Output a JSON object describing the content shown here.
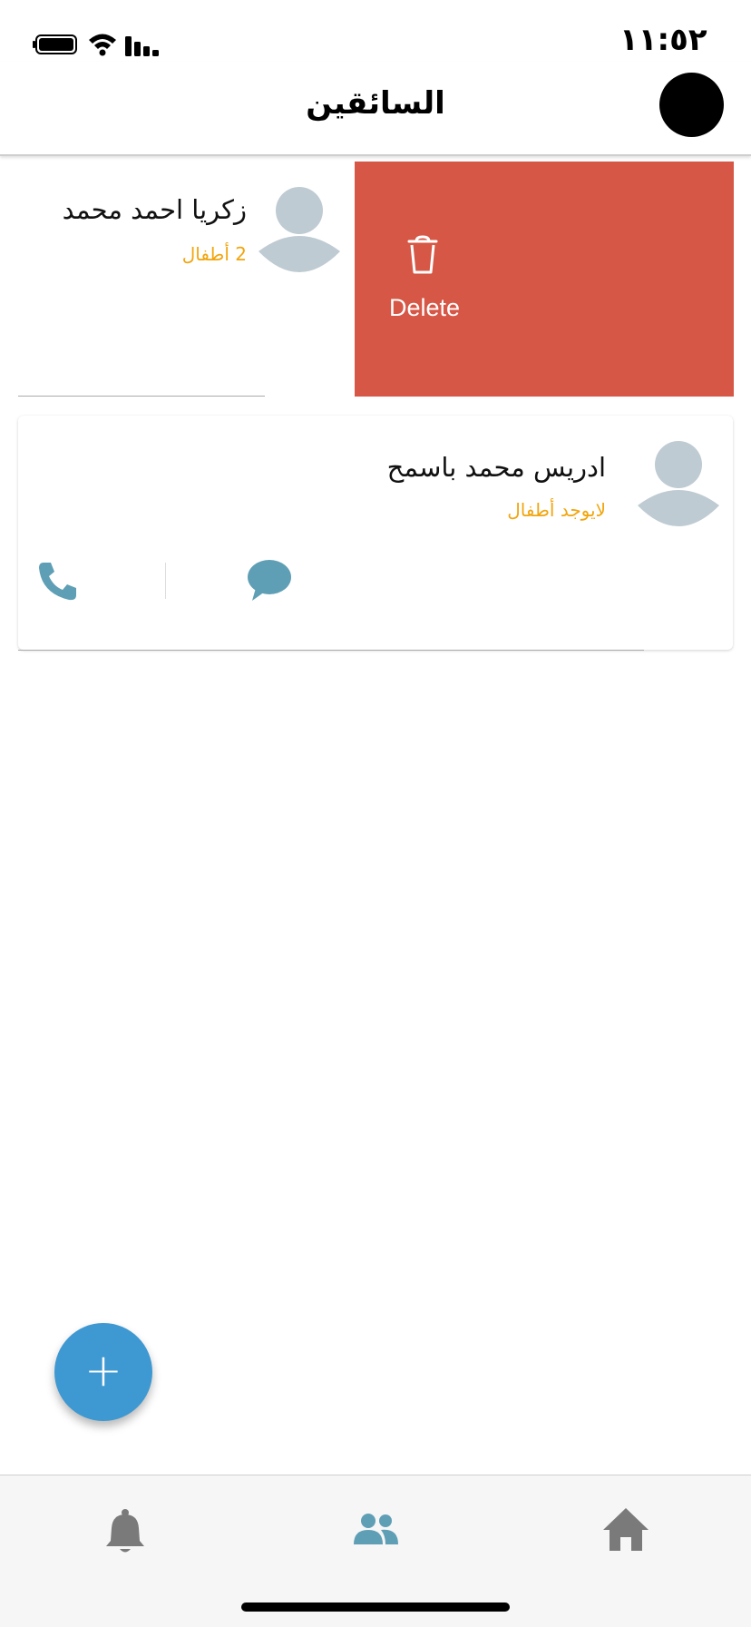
{
  "status_bar": {
    "time": "١١:٥٢"
  },
  "header": {
    "title": "السائقين"
  },
  "swipe_action": {
    "delete_label": "Delete"
  },
  "drivers": [
    {
      "name": "زكريا احمد محمد",
      "children": "2 أطفال"
    },
    {
      "name": "ادريس محمد باسمح",
      "children": "لايوجد أطفال"
    }
  ],
  "fab": {
    "icon": "plus-icon",
    "label": "+"
  },
  "bottom_nav": {
    "items": [
      {
        "icon": "bell-icon"
      },
      {
        "icon": "users-icon",
        "active": true
      },
      {
        "icon": "home-icon"
      }
    ]
  },
  "colors": {
    "delete_bg": "#d65746",
    "accent": "#5f9fb5",
    "subtitle": "#f2a50e",
    "fab": "#3e98d2"
  }
}
